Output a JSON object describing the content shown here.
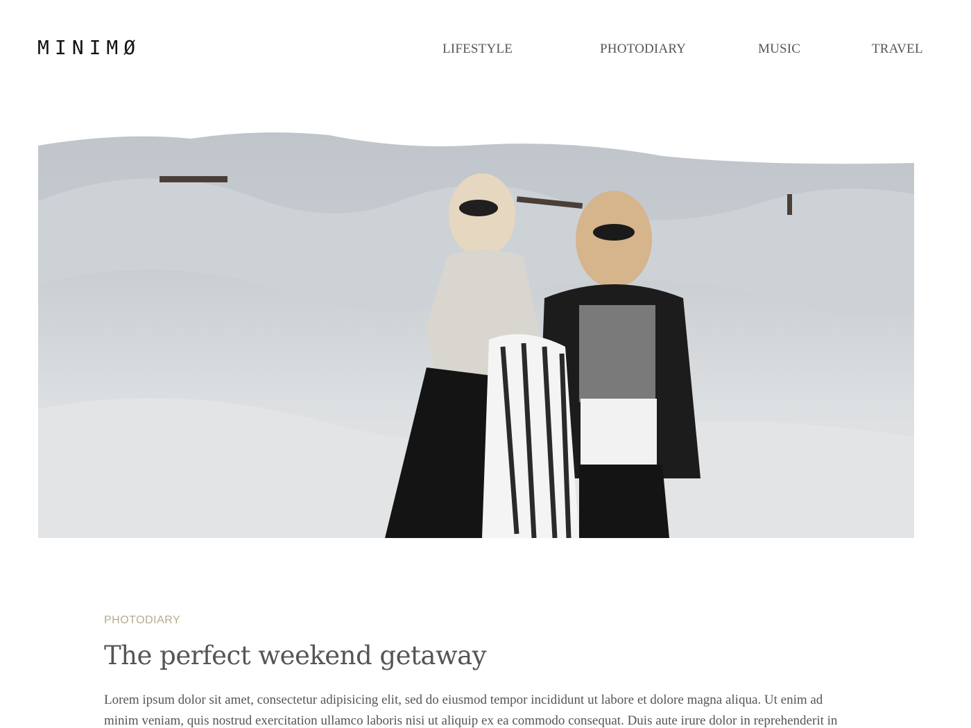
{
  "header": {
    "logo": "MINIMØ",
    "nav": [
      "LIFESTYLE",
      "PHOTODIARY",
      "MUSIC",
      "TRAVEL"
    ]
  },
  "hero": {
    "image": "two-women-on-dunes-photo"
  },
  "article": {
    "category": "PHOTODIARY",
    "title": "The perfect weekend getaway",
    "excerpt": "Lorem ipsum dolor sit amet, consectetur adipisicing elit, sed do eiusmod tempor incididunt ut labore et dolore magna aliqua. Ut enim ad minim veniam, quis nostrud exercitation ullamco laboris nisi ut aliquip ex ea commodo consequat. Duis aute irure dolor in reprehenderit in"
  },
  "colors": {
    "accent": "#b8a98e",
    "text": "#555555",
    "logo": "#111111"
  }
}
